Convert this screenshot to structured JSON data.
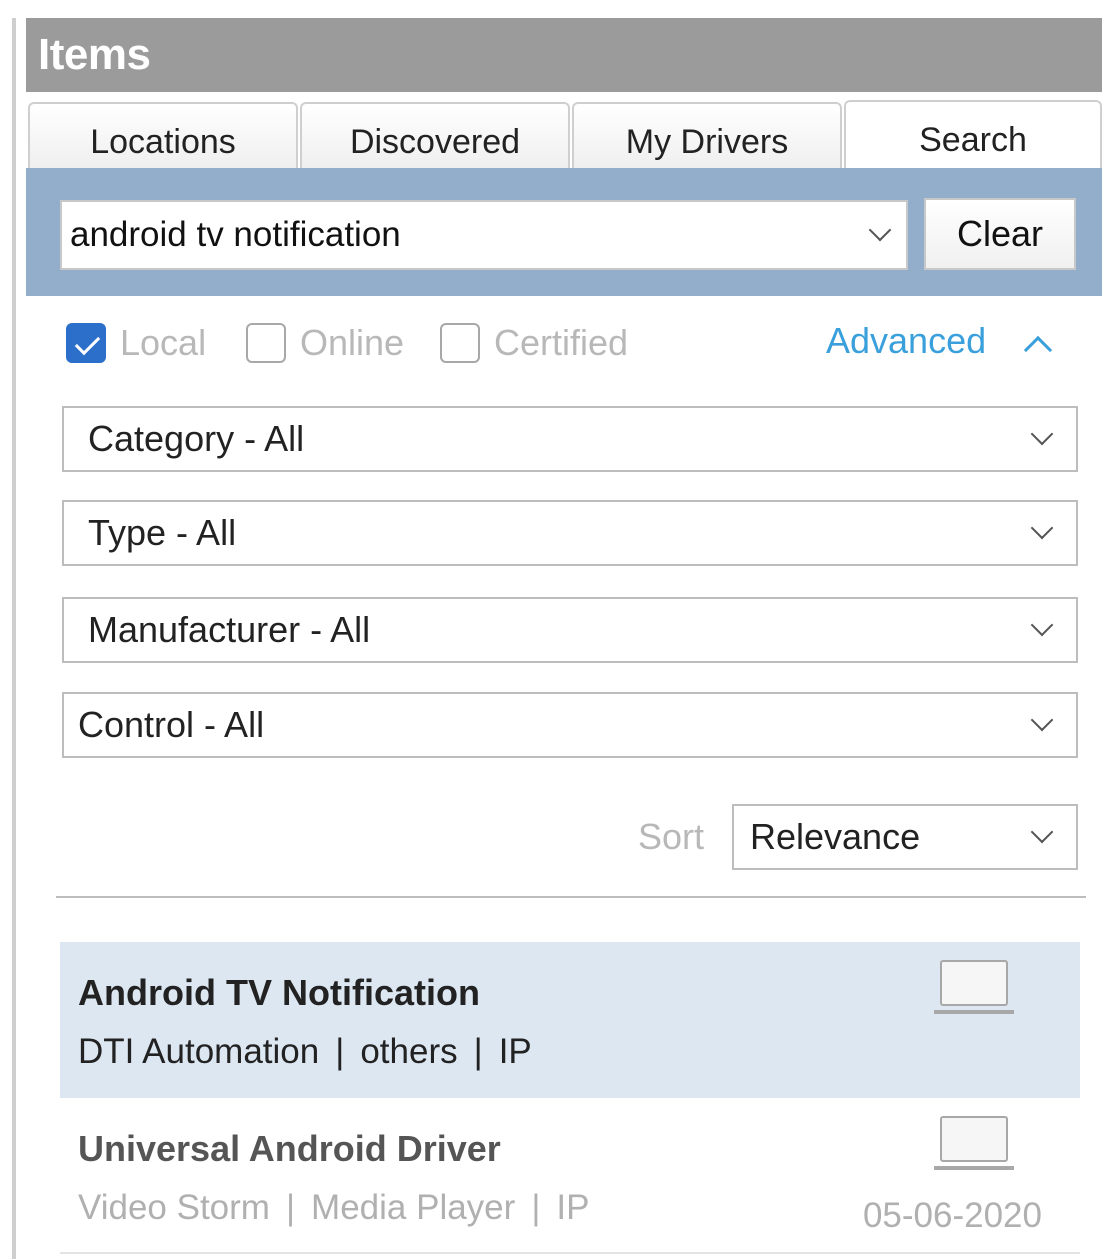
{
  "panel": {
    "title": "Items"
  },
  "tabs": [
    {
      "label": "Locations"
    },
    {
      "label": "Discovered"
    },
    {
      "label": "My Drivers"
    },
    {
      "label": "Search"
    }
  ],
  "search": {
    "value": "android tv notification",
    "clear_label": "Clear"
  },
  "filters": {
    "local_label": "Local",
    "local_checked": true,
    "online_label": "Online",
    "online_checked": false,
    "certified_label": "Certified",
    "certified_checked": false,
    "advanced_label": "Advanced"
  },
  "dropdowns": {
    "category": "Category - All",
    "type": "Type - All",
    "manufacturer": "Manufacturer - All",
    "control": "Control - All"
  },
  "sort": {
    "label": "Sort",
    "value": "Relevance"
  },
  "results": [
    {
      "name": "Android TV Notification",
      "manufacturer": "DTI Automation",
      "type": "others",
      "control": "IP",
      "date": ""
    },
    {
      "name": "Universal Android Driver",
      "manufacturer": "Video Storm",
      "type": "Media Player",
      "control": "IP",
      "date": "05-06-2020"
    }
  ],
  "separator": "|",
  "colors": {
    "title_bar": "#9b9b9b",
    "search_band": "#92aecb",
    "accent": "#3aa0dc",
    "checkbox": "#2b6fcb",
    "selected_row": "#dce7f2"
  },
  "icons": {
    "result_device": "laptop-icon"
  }
}
